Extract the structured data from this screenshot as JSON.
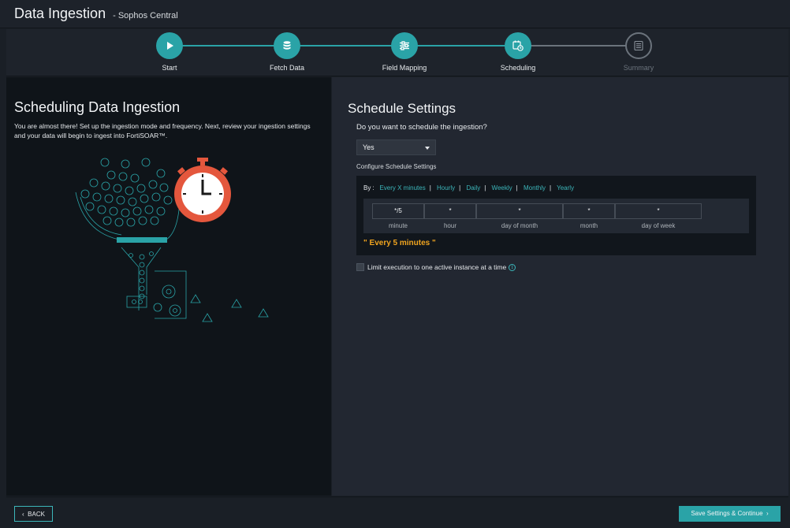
{
  "header": {
    "title": "Data Ingestion",
    "subtitle": "- Sophos Central"
  },
  "stepper": {
    "steps": [
      {
        "label": "Start",
        "icon": "play-icon",
        "state": "complete"
      },
      {
        "label": "Fetch Data",
        "icon": "database-icon",
        "state": "complete"
      },
      {
        "label": "Field Mapping",
        "icon": "sliders-icon",
        "state": "complete"
      },
      {
        "label": "Scheduling",
        "icon": "calendar-clock-icon",
        "state": "active"
      },
      {
        "label": "Summary",
        "icon": "document-list-icon",
        "state": "inactive"
      }
    ],
    "accent": "#2aa3a7"
  },
  "left": {
    "title": "Scheduling Data Ingestion",
    "description": "You are almost there! Set up the ingestion mode and frequency. Next, review your ingestion settings and your data will begin to ingest into FortiSOAR™."
  },
  "right": {
    "title": "Schedule Settings",
    "question": "Do you want to schedule the ingestion?",
    "schedule_select": "Yes",
    "configure_label": "Configure Schedule Settings",
    "by_label": "By :",
    "by_options": [
      "Every X minutes",
      "Hourly",
      "Daily",
      "Weekly",
      "Monthly",
      "Yearly"
    ],
    "cron": {
      "fields": [
        "*/5",
        "*",
        "*",
        "*",
        "*"
      ],
      "labels": [
        "minute",
        "hour",
        "day of month",
        "month",
        "day of week"
      ],
      "summary": "\" Every 5 minutes \""
    },
    "limit_label": "Limit execution to one active instance at a time",
    "limit_checked": false
  },
  "footer": {
    "back_label": "BACK",
    "save_label": "Save Settings & Continue"
  }
}
